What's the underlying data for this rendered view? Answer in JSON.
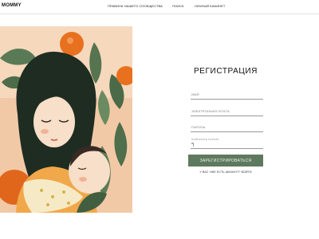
{
  "header": {
    "logo": "MOMMY",
    "nav": [
      {
        "label": "ПРАВИЛА НАШЕГО СООБЩЕСТВА"
      },
      {
        "label": "ПОИСК"
      },
      {
        "label": "ЛИЧНЫЙ КАБИНЕТ"
      }
    ]
  },
  "form": {
    "title": "РЕГИСТРАЦИЯ",
    "fields": {
      "name": {
        "placeholder": "ИМЯ"
      },
      "email": {
        "placeholder": "ЭЛЕКТРОННАЯ ПОЧТА"
      },
      "password": {
        "placeholder": "ПАРОЛЬ"
      },
      "confirm": {
        "label": "ПОВТОРИТЕ ПАРОЛЬ",
        "value": "*|"
      }
    },
    "submit_label": "ЗАРЕГИСТРИРОВАТЬСЯ",
    "login_prompt": "У ВАС УЖЕ ЕСТЬ АККАУНТ?",
    "login_link": "ВОЙТИ"
  },
  "colors": {
    "accent": "#5e7a5e",
    "illustration_bg": "#f3c8a3",
    "orange": "#e8711f",
    "leaf": "#4c6b4b",
    "hair": "#1f2c22"
  }
}
